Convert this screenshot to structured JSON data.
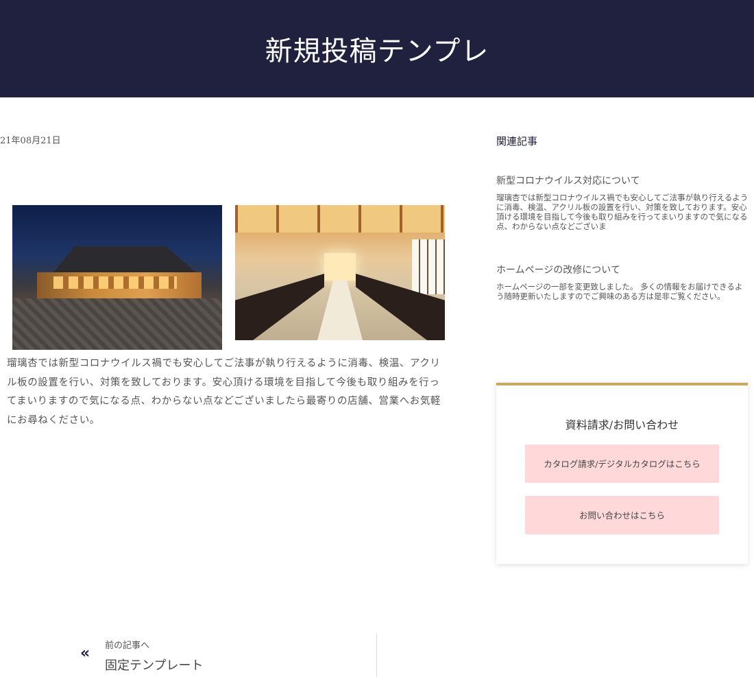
{
  "header": {
    "title": "新規投稿テンプレ"
  },
  "post": {
    "date": "21年08月21日",
    "body": "瑠璃杏では新型コロナウイルス禍でも安心してご法事が執り行えるように消毒、検温、アクリル板の設置を行い、対策を致しております。安心頂ける環境を目指して今後も取り組みを行ってまいりますので気になる点、わからない点などございましたら最寄りの店舗、営業へお気軽にお尋ねください。"
  },
  "sidebar": {
    "related_heading": "関連記事",
    "related": [
      {
        "title": "新型コロナウイルス対応について",
        "excerpt": "瑠璃杏では新型コロナウイルス禍でも安心してご法事が執り行えるように消毒、検温、アクリル板の設置を行い、対策を致しております。安心頂ける環境を目指して今後も取り組みを行ってまいりますので気になる点、わからない点などございま"
      },
      {
        "title": "ホームページの改修について",
        "excerpt": "ホームページの一部を変更致しました。 多くの情報をお届けできるよう随時更新いたしますのでご興味のある方は是非ご覧ください。"
      }
    ],
    "contact": {
      "title": "資料請求/お問い合わせ",
      "catalog_button": "カタログ請求/デジタルカタログはこちら",
      "inquiry_button": "お問い合わせはこちら"
    }
  },
  "nav": {
    "prev_label": "前の記事へ",
    "prev_title": "固定テンプレート",
    "prev_arrow": "«"
  },
  "colors": {
    "header_bg": "#20203f",
    "accent_gold": "#c9a860",
    "button_pink": "#ffd9da"
  }
}
